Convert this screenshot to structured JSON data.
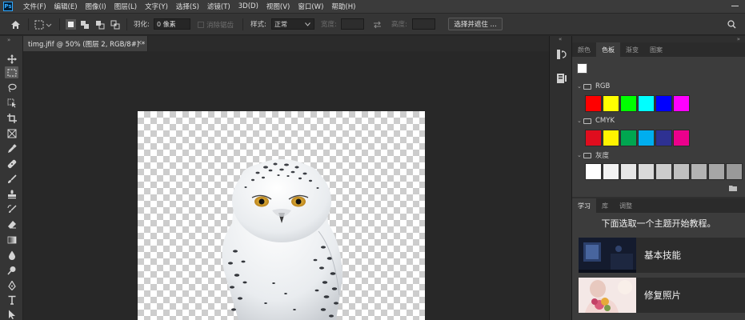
{
  "app": {
    "logo": "Ps",
    "menu": [
      "文件(F)",
      "编辑(E)",
      "图像(I)",
      "图层(L)",
      "文字(Y)",
      "选择(S)",
      "滤镜(T)",
      "3D(D)",
      "视图(V)",
      "窗口(W)",
      "帮助(H)"
    ]
  },
  "options": {
    "feather_label": "羽化:",
    "feather_value": "0 像素",
    "antialias_label": "消除锯齿",
    "style_label": "样式:",
    "style_value": "正常",
    "width_label": "宽度:",
    "height_label": "高度:",
    "select_mask": "选择并遮住 ..."
  },
  "document": {
    "tab_title": "timg.jfif @ 50% (图层 2, RGB/8#) *",
    "close": "×"
  },
  "panel_tabs": [
    "颜色",
    "色板",
    "渐变",
    "图案"
  ],
  "active_panel_tab": "色板",
  "swatch_groups": [
    {
      "name": "RGB",
      "colors": [
        "#ff0000",
        "#ffff00",
        "#00ff00",
        "#00ffff",
        "#0000ff",
        "#ff00ff"
      ]
    },
    {
      "name": "CMYK",
      "colors": [
        "#e00d1e",
        "#fff200",
        "#00a650",
        "#00aeef",
        "#2e3192",
        "#ec008c"
      ]
    },
    {
      "name": "灰度",
      "colors": [
        "#ffffff",
        "#f2f2f2",
        "#e6e6e6",
        "#d9d9d9",
        "#cccccc",
        "#c0c0c0",
        "#b3b3b3",
        "#a6a6a6",
        "#999999"
      ]
    }
  ],
  "learn_tabs": [
    "学习",
    "库",
    "调整"
  ],
  "learn": {
    "heading": "下面选取一个主题开始教程。",
    "cards": [
      {
        "label": "基本技能"
      },
      {
        "label": "修复照片"
      }
    ]
  },
  "colors": {
    "accent": "#31a8ff",
    "panel": "#3c3c3c",
    "canvas_bg": "#282828"
  }
}
